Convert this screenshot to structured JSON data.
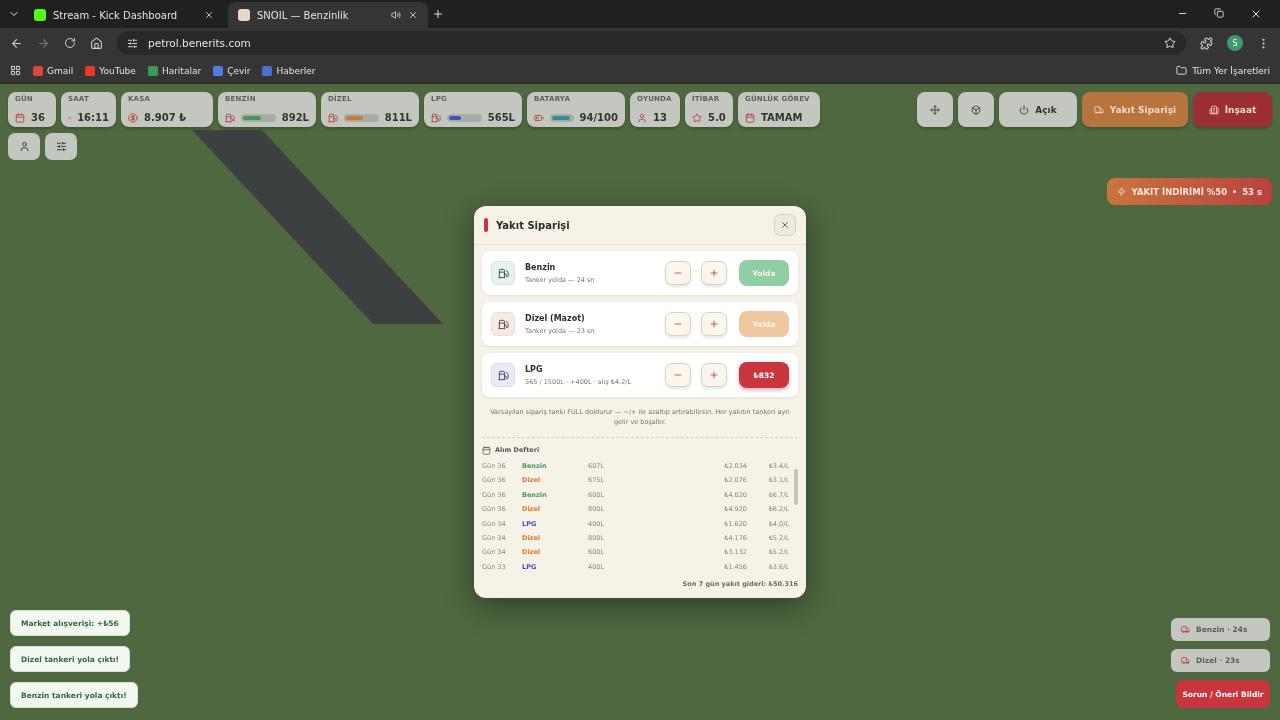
{
  "browser": {
    "tabs": [
      {
        "title": "Stream - Kick Dashboard",
        "selected": false
      },
      {
        "title": "SNOIL — Benzinlik",
        "selected": true
      }
    ],
    "address": "petrol.benerits.com",
    "bookmarks": [
      "Gmail",
      "YouTube",
      "Haritalar",
      "Çevir",
      "Haberler"
    ],
    "all_bookmarks": "Tüm Yer İşaretleri",
    "profile": "S"
  },
  "hud": {
    "stats": [
      {
        "kind": "plain",
        "label": "GÜN",
        "value": "36"
      },
      {
        "kind": "plain",
        "label": "SAAT",
        "value": "16:11"
      },
      {
        "kind": "plain",
        "label": "KASA",
        "value": "8.907 ₺"
      },
      {
        "kind": "meter",
        "label": "BENZİN",
        "value": "892L",
        "level": 0.6,
        "color": "#3f9a5c"
      },
      {
        "kind": "meter",
        "label": "DİZEL",
        "value": "811L",
        "level": 0.55,
        "color": "#c9773a"
      },
      {
        "kind": "meter",
        "label": "LPG",
        "value": "565L",
        "level": 0.38,
        "color": "#3b54c4"
      },
      {
        "kind": "meter",
        "label": "BATARYA",
        "value": "94/100",
        "level": 0.94,
        "color": "#2e8f9a"
      },
      {
        "kind": "plain",
        "label": "OYUNDA",
        "value": "13"
      },
      {
        "kind": "plain",
        "label": "İTİBAR",
        "value": "5.0"
      },
      {
        "kind": "plain",
        "label": "GÜNLÜK GÖREV",
        "value": "TAMAM"
      }
    ],
    "actions": [
      {
        "kind": "icon"
      },
      {
        "kind": "icon"
      },
      {
        "kind": "neutral",
        "label": "Açık"
      },
      {
        "kind": "orange",
        "label": "Yakıt Siparişi"
      },
      {
        "kind": "red",
        "label": "İnşaat"
      }
    ],
    "promo": {
      "text": "YAKIT İNDİRİMİ %50",
      "timer": "53 s"
    }
  },
  "modal": {
    "title": "Yakıt Siparişi",
    "fuels": [
      {
        "name": "Benzin",
        "detail": "Tanker yolda — 24 sn",
        "action": "Yolda",
        "in_transit": true,
        "color": "#8fcfa3"
      },
      {
        "name": "Dizel (Mazot)",
        "detail": "Tanker yolda — 23 sn",
        "action": "Yolda",
        "in_transit": true,
        "color": "#efc79e"
      },
      {
        "name": "LPG",
        "detail": "565 / 1500L · +400L · alış ₺4.2/L",
        "action": "₺832",
        "in_transit": false,
        "color": "#c8353d"
      }
    ],
    "note": "Varsayılan sipariş tankı FULL doldurur — −/+ ile azaltıp artırabilirsin. Her yakıtın tankeri ayrı gelir ve boşaltır.",
    "ledger": {
      "title": "Alım Defteri",
      "rows": [
        {
          "day": "Gün 36",
          "fuel": "Benzin",
          "color": "#3f9a5c",
          "qty": "607L",
          "total": "₺2.034",
          "unit": "₺3.4/L"
        },
        {
          "day": "Gün 36",
          "fuel": "Dizel",
          "color": "#d9782e",
          "qty": "675L",
          "total": "₺2.076",
          "unit": "₺3.1/L"
        },
        {
          "day": "Gün 36",
          "fuel": "Benzin",
          "color": "#3f9a5c",
          "qty": "600L",
          "total": "₺4.020",
          "unit": "₺6.7/L"
        },
        {
          "day": "Gün 36",
          "fuel": "Dizel",
          "color": "#d9782e",
          "qty": "800L",
          "total": "₺4.920",
          "unit": "₺6.2/L"
        },
        {
          "day": "Gün 34",
          "fuel": "LPG",
          "color": "#3b54c4",
          "qty": "400L",
          "total": "₺1.620",
          "unit": "₺4.0/L"
        },
        {
          "day": "Gün 34",
          "fuel": "Dizel",
          "color": "#d9782e",
          "qty": "800L",
          "total": "₺4.176",
          "unit": "₺5.2/L"
        },
        {
          "day": "Gün 34",
          "fuel": "Dizel",
          "color": "#d9782e",
          "qty": "600L",
          "total": "₺3.132",
          "unit": "₺5.2/L"
        },
        {
          "day": "Gün 33",
          "fuel": "LPG",
          "color": "#3b54c4",
          "qty": "400L",
          "total": "₺1.456",
          "unit": "₺3.6/L"
        }
      ],
      "summary": "Son 7 gün yakıt gideri: ₺50.316"
    }
  },
  "toasts": [
    "Market alışverişi: +₺56",
    "Dizel tankeri yola çıktı!",
    "Benzin tankeri yola çıktı!"
  ],
  "tankers": [
    "Benzin · 24s",
    "Dizel · 23s"
  ],
  "report_button": "Sorun / Öneri Bildir"
}
